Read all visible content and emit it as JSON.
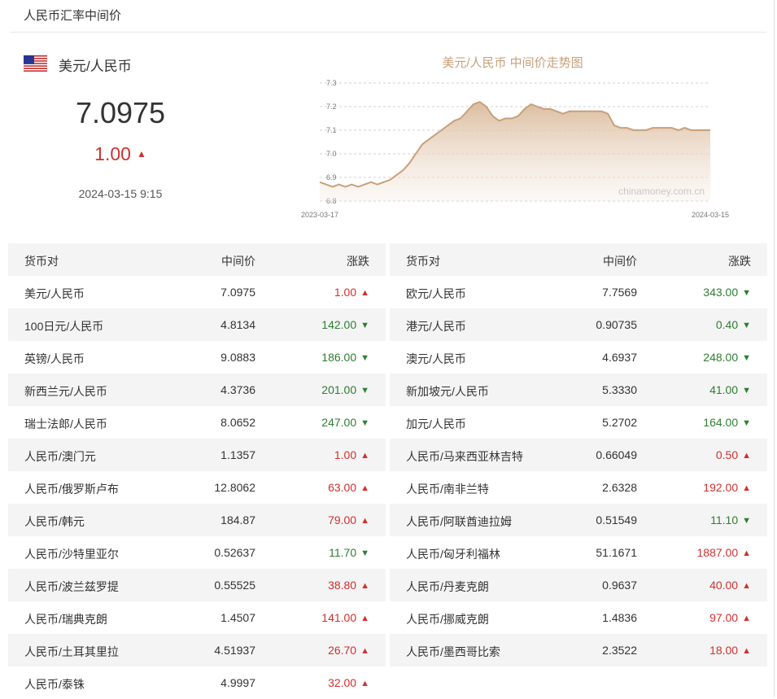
{
  "header": {
    "title": "人民币汇率中间价"
  },
  "featured": {
    "flag_icon": "us-flag-icon",
    "pair": "美元/人民币",
    "rate": "7.0975",
    "change": "1.00",
    "direction": "up",
    "timestamp": "2024-03-15 9:15"
  },
  "chart_data": {
    "type": "area",
    "title": "美元/人民币 中间价走势图",
    "y_ticks": [
      "7.3",
      "7.2",
      "7.1",
      "7.0",
      "6.9",
      "6.8"
    ],
    "ylim": [
      6.8,
      7.3
    ],
    "x_labels": [
      "2023-03-17",
      "2024-03-15"
    ],
    "watermark": "chinamoney.com.cn",
    "grid": true,
    "series": [
      {
        "values": [
          6.88,
          6.87,
          6.86,
          6.87,
          6.86,
          6.87,
          6.86,
          6.87,
          6.88,
          6.87,
          6.88,
          6.89,
          6.91,
          6.93,
          6.96,
          7.0,
          7.04,
          7.06,
          7.08,
          7.1,
          7.12,
          7.14,
          7.15,
          7.18,
          7.21,
          7.22,
          7.2,
          7.16,
          7.14,
          7.15,
          7.15,
          7.16,
          7.19,
          7.21,
          7.2,
          7.19,
          7.19,
          7.18,
          7.17,
          7.18,
          7.18,
          7.18,
          7.18,
          7.18,
          7.18,
          7.17,
          7.12,
          7.11,
          7.11,
          7.1,
          7.1,
          7.1,
          7.11,
          7.11,
          7.11,
          7.11,
          7.1,
          7.11,
          7.1,
          7.1,
          7.1,
          7.1
        ]
      }
    ]
  },
  "table_headers": {
    "pair": "货币对",
    "mid": "中间价",
    "change": "涨跌"
  },
  "left_rows": [
    {
      "pair": "美元/人民币",
      "mid": "7.0975",
      "change": "1.00",
      "dir": "up"
    },
    {
      "pair": "100日元/人民币",
      "mid": "4.8134",
      "change": "142.00",
      "dir": "down"
    },
    {
      "pair": "英镑/人民币",
      "mid": "9.0883",
      "change": "186.00",
      "dir": "down"
    },
    {
      "pair": "新西兰元/人民币",
      "mid": "4.3736",
      "change": "201.00",
      "dir": "down"
    },
    {
      "pair": "瑞士法郎/人民币",
      "mid": "8.0652",
      "change": "247.00",
      "dir": "down"
    },
    {
      "pair": "人民币/澳门元",
      "mid": "1.1357",
      "change": "1.00",
      "dir": "up"
    },
    {
      "pair": "人民币/俄罗斯卢布",
      "mid": "12.8062",
      "change": "63.00",
      "dir": "up"
    },
    {
      "pair": "人民币/韩元",
      "mid": "184.87",
      "change": "79.00",
      "dir": "up"
    },
    {
      "pair": "人民币/沙特里亚尔",
      "mid": "0.52637",
      "change": "11.70",
      "dir": "down"
    },
    {
      "pair": "人民币/波兰兹罗提",
      "mid": "0.55525",
      "change": "38.80",
      "dir": "up"
    },
    {
      "pair": "人民币/瑞典克朗",
      "mid": "1.4507",
      "change": "141.00",
      "dir": "up"
    },
    {
      "pair": "人民币/土耳其里拉",
      "mid": "4.51937",
      "change": "26.70",
      "dir": "up"
    },
    {
      "pair": "人民币/泰铢",
      "mid": "4.9997",
      "change": "32.00",
      "dir": "up"
    }
  ],
  "right_rows": [
    {
      "pair": "欧元/人民币",
      "mid": "7.7569",
      "change": "343.00",
      "dir": "down"
    },
    {
      "pair": "港元/人民币",
      "mid": "0.90735",
      "change": "0.40",
      "dir": "down"
    },
    {
      "pair": "澳元/人民币",
      "mid": "4.6937",
      "change": "248.00",
      "dir": "down"
    },
    {
      "pair": "新加坡元/人民币",
      "mid": "5.3330",
      "change": "41.00",
      "dir": "down"
    },
    {
      "pair": "加元/人民币",
      "mid": "5.2702",
      "change": "164.00",
      "dir": "down"
    },
    {
      "pair": "人民币/马来西亚林吉特",
      "mid": "0.66049",
      "change": "0.50",
      "dir": "up"
    },
    {
      "pair": "人民币/南非兰特",
      "mid": "2.6328",
      "change": "192.00",
      "dir": "up"
    },
    {
      "pair": "人民币/阿联酋迪拉姆",
      "mid": "0.51549",
      "change": "11.10",
      "dir": "down"
    },
    {
      "pair": "人民币/匈牙利福林",
      "mid": "51.1671",
      "change": "1887.00",
      "dir": "up"
    },
    {
      "pair": "人民币/丹麦克朗",
      "mid": "0.9637",
      "change": "40.00",
      "dir": "up"
    },
    {
      "pair": "人民币/挪威克朗",
      "mid": "1.4836",
      "change": "97.00",
      "dir": "up"
    },
    {
      "pair": "人民币/墨西哥比索",
      "mid": "2.3522",
      "change": "18.00",
      "dir": "up"
    }
  ],
  "colors": {
    "up": "#d32f2f",
    "down": "#2e7d32",
    "chart_line": "#c8a07a"
  }
}
